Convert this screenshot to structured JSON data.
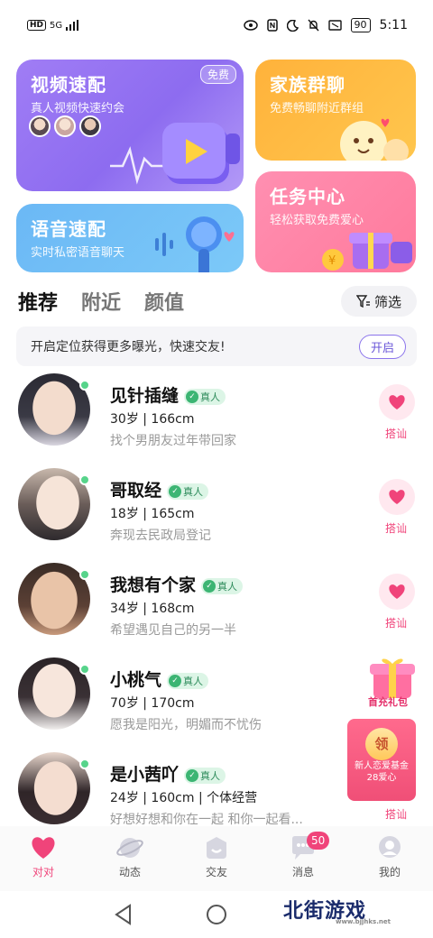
{
  "status": {
    "network": "HD",
    "signal": "5G",
    "battery": "90",
    "time": "5:11"
  },
  "cards": {
    "video": {
      "title": "视频速配",
      "subtitle": "真人视频快速约会",
      "badge": "免费"
    },
    "voice": {
      "title": "语音速配",
      "subtitle": "实时私密语音聊天"
    },
    "family": {
      "title": "家族群聊",
      "subtitle": "免费畅聊附近群组"
    },
    "task": {
      "title": "任务中心",
      "subtitle": "轻松获取免费爱心"
    }
  },
  "tabs": [
    {
      "label": "推荐"
    },
    {
      "label": "附近"
    },
    {
      "label": "颜值"
    }
  ],
  "filter_label": "筛选",
  "location_banner": {
    "text": "开启定位获得更多曝光，快速交友!",
    "button": "开启"
  },
  "verified_label": "真人",
  "action_label": "搭讪",
  "users": [
    {
      "name": "见针插缝",
      "meta": "30岁 | 166cm",
      "bio": "找个男朋友过年带回家"
    },
    {
      "name": "哥取经",
      "meta": "18岁 | 165cm",
      "bio": "奔现去民政局登记"
    },
    {
      "name": "我想有个家",
      "meta": "34岁 | 168cm",
      "bio": "希望遇见自己的另一半"
    },
    {
      "name": "小桃气",
      "meta": "70岁 | 170cm",
      "bio": "愿我是阳光，明媚而不忧伤"
    },
    {
      "name": "是小茜吖",
      "meta": "24岁 | 160cm | 个体经营",
      "bio": "好想好想和你在一起 和你一起看..."
    }
  ],
  "promos": {
    "first_charge": "首充礼包",
    "newbie_seal": "领",
    "newbie_line1": "新人恋爱基金",
    "newbie_line2": "28爱心"
  },
  "nav": [
    {
      "label": "对对",
      "icon": "heart-icon"
    },
    {
      "label": "动态",
      "icon": "planet-icon"
    },
    {
      "label": "交友",
      "icon": "friends-icon"
    },
    {
      "label": "消息",
      "icon": "chat-icon",
      "badge": "50"
    },
    {
      "label": "我的",
      "icon": "profile-icon"
    }
  ],
  "watermark": {
    "text": "北街游戏",
    "url_text": "www.bjjhks.net"
  },
  "colors": {
    "accent": "#f0447a",
    "video_card": "#9b78f3",
    "voice_card": "#6bb8f5",
    "family_card": "#ffb23b",
    "task_card": "#ff8fb1"
  }
}
